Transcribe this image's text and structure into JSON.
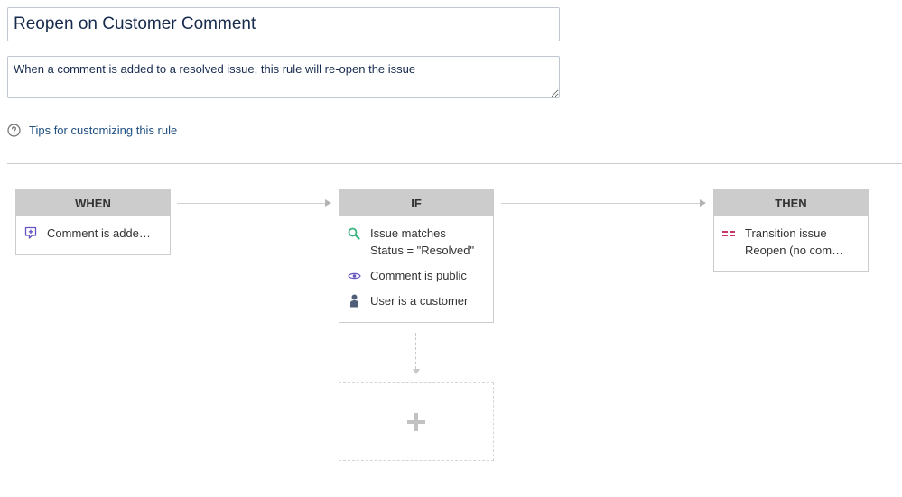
{
  "rule": {
    "name": "Reopen on Customer Comment",
    "description": "When a comment is added to a resolved issue, this rule will re-open the issue"
  },
  "tips": {
    "label": "Tips for customizing this rule",
    "icon": "question-circle-icon"
  },
  "colors": {
    "header_bg": "#cccccc",
    "link": "#205081",
    "comment_icon": "#6554c0",
    "search_icon": "#36b37e",
    "eye_icon": "#6554c0",
    "person_icon": "#505f79",
    "transition_icon": "#c9356d"
  },
  "cards": {
    "when": {
      "header": "WHEN",
      "items": [
        {
          "icon": "comment-add-icon",
          "line1": "Comment is adde…"
        }
      ]
    },
    "if": {
      "header": "IF",
      "items": [
        {
          "icon": "search-icon",
          "line1": "Issue matches",
          "line2": "Status = \"Resolved\""
        },
        {
          "icon": "eye-icon",
          "line1": "Comment is public"
        },
        {
          "icon": "user-icon",
          "line1": "User is a customer"
        }
      ]
    },
    "then": {
      "header": "THEN",
      "items": [
        {
          "icon": "transition-icon",
          "line1": "Transition issue",
          "line2": "Reopen (no com…"
        }
      ]
    }
  },
  "add_branch": {
    "icon": "plus-icon"
  }
}
